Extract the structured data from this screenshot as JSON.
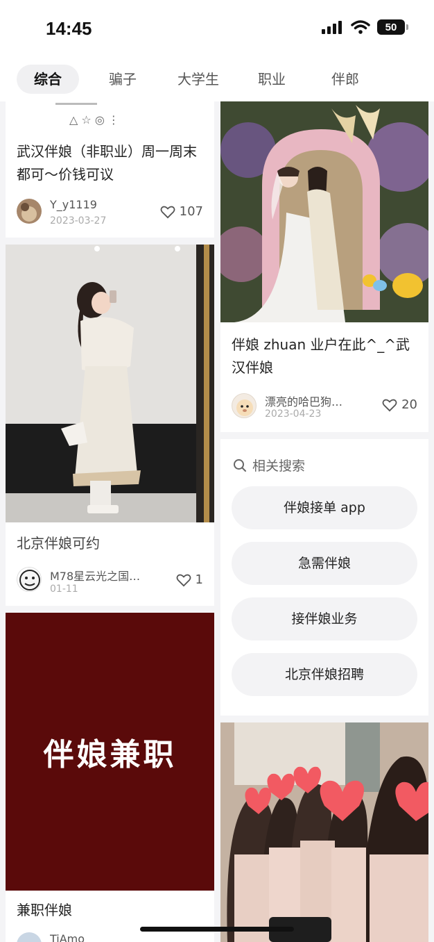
{
  "status_bar": {
    "time": "14:45",
    "battery": "50"
  },
  "tabs": [
    {
      "label": "综合",
      "active": true
    },
    {
      "label": "骗子",
      "active": false
    },
    {
      "label": "大学生",
      "active": false
    },
    {
      "label": "职业",
      "active": false
    },
    {
      "label": "伴郎",
      "active": false
    }
  ],
  "feed_left": [
    {
      "title": "武汉伴娘（非职业）周一周末都可～价钱可议",
      "author": "Y_y1119",
      "date": "2023-03-27",
      "likes": "107"
    },
    {
      "title": "北京伴娘可约",
      "author": "M78星云光之国…",
      "date": "01-11",
      "likes": "1"
    },
    {
      "image_text": "伴娘兼职",
      "title": "兼职伴娘",
      "author": "TiAmo"
    }
  ],
  "feed_right": [
    {
      "title": "伴娘 zhuan 业户在此^_^武汉伴娘",
      "author": "漂亮的哈巴狗…",
      "date": "2023-04-23",
      "likes": "20"
    }
  ],
  "related_search": {
    "heading": "相关搜索",
    "items": [
      "伴娘接单 app",
      "急需伴娘",
      "接伴娘业务",
      "北京伴娘招聘"
    ]
  },
  "colors": {
    "accent_dark_red": "#5a0a0a",
    "background": "#f4f4f6"
  }
}
